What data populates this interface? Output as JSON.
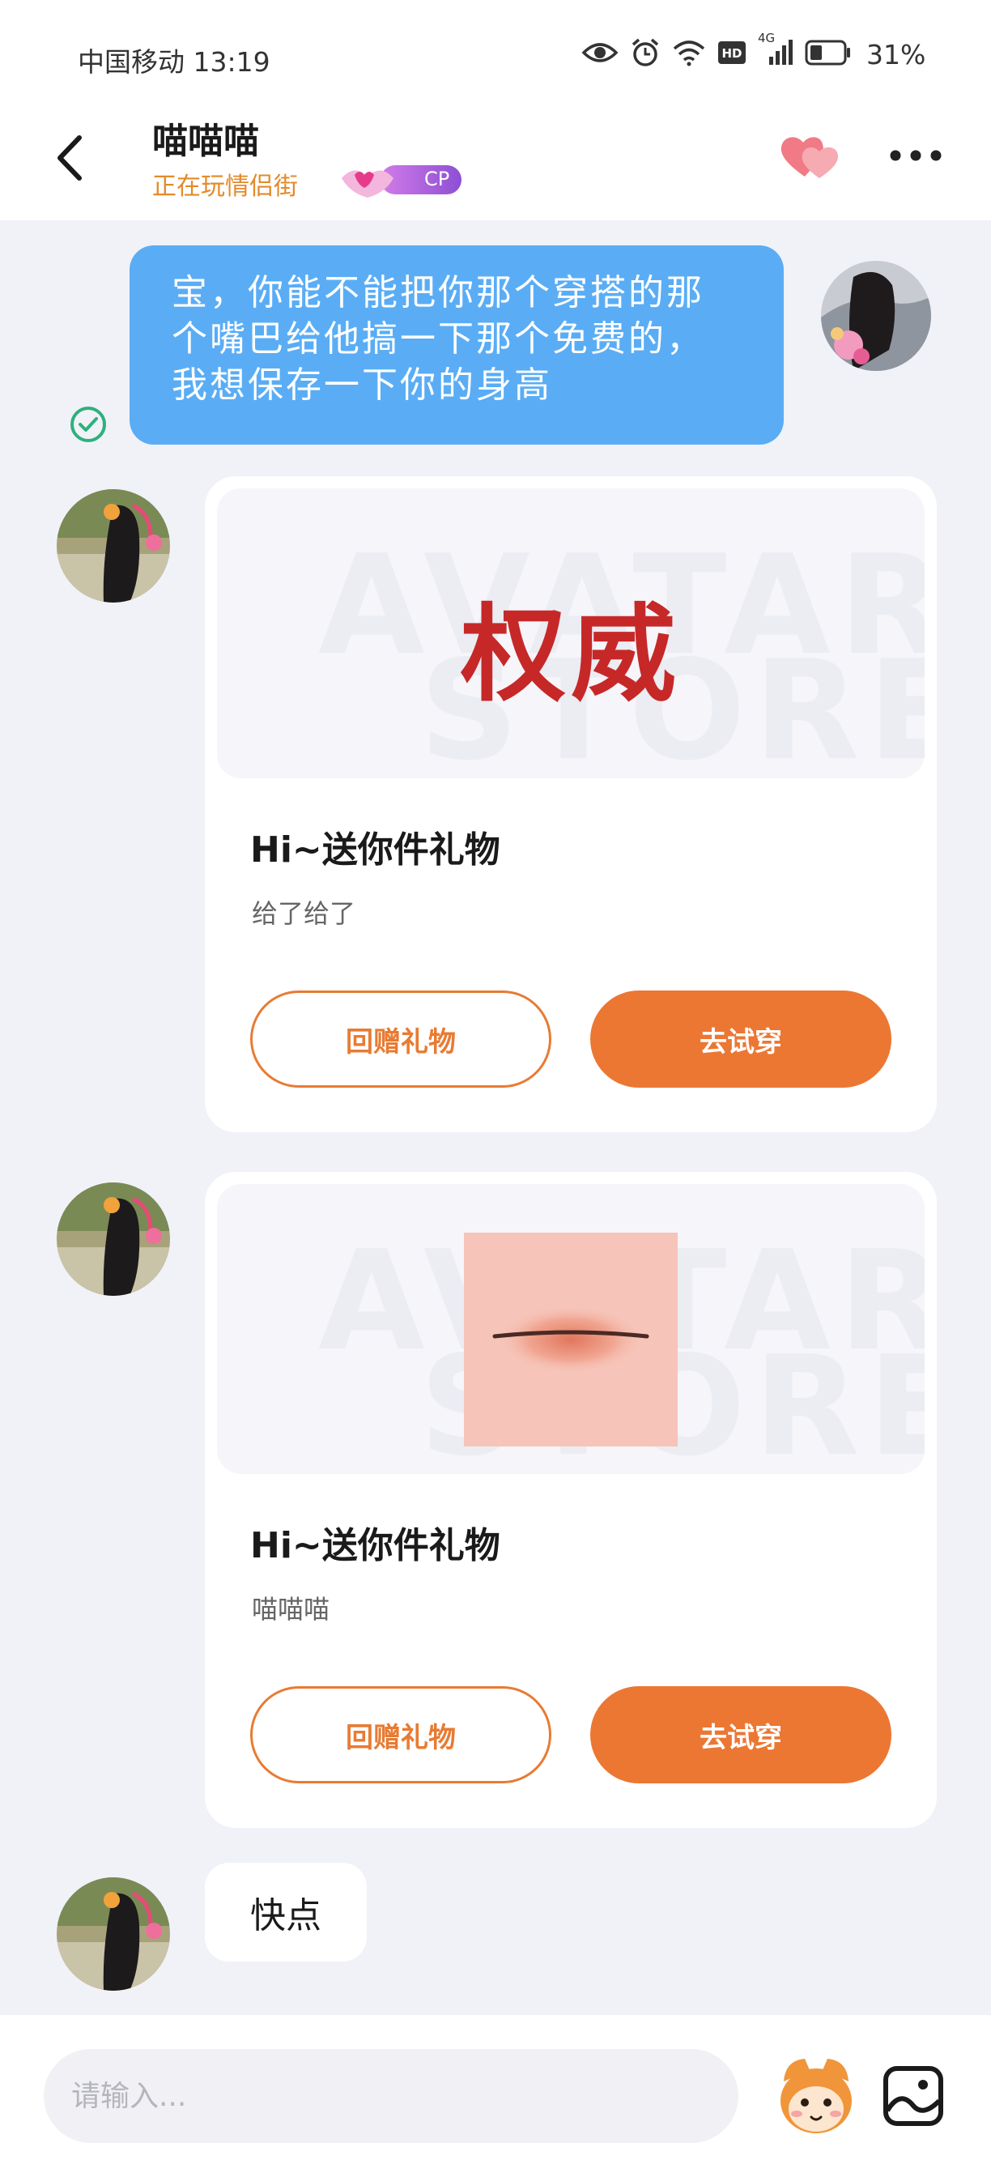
{
  "status_bar": {
    "carrier_time": "中国移动 13:19",
    "network_label": "4G",
    "battery_percent": "31%",
    "icons": [
      "eye-icon",
      "alarm-icon",
      "wifi-icon",
      "hd-icon",
      "signal-icon",
      "battery-icon"
    ]
  },
  "header": {
    "contact_name": "喵喵喵",
    "contact_status": "正在玩情侣街",
    "cp_badge": "CP",
    "icons": [
      "back-arrow-icon",
      "hearts-icon",
      "more-icon"
    ]
  },
  "messages": {
    "outgoing_text": "宝，你能不能把你那个穿搭的那个嘴巴给他搞一下那个免费的，我想保存一下你的身高",
    "gift_cards": [
      {
        "image_text": "权威",
        "watermark_line1": "AVATAR",
        "watermark_line2": "STORE",
        "title": "Hi~送你件礼物",
        "subtitle": "给了给了",
        "return_label": "回赠礼物",
        "try_label": "去试穿"
      },
      {
        "image_kind": "lips",
        "watermark_line1": "AVATAR",
        "watermark_line2": "STORE",
        "title": "Hi~送你件礼物",
        "subtitle": "喵喵喵",
        "return_label": "回赠礼物",
        "try_label": "去试穿"
      }
    ],
    "incoming_text": "快点"
  },
  "input": {
    "placeholder": "请输入...",
    "value": ""
  },
  "colors": {
    "accent_orange": "#ec7733",
    "bubble_blue": "#5aadf5",
    "background": "#f1f2f8",
    "status_orange": "#e48a2a"
  }
}
